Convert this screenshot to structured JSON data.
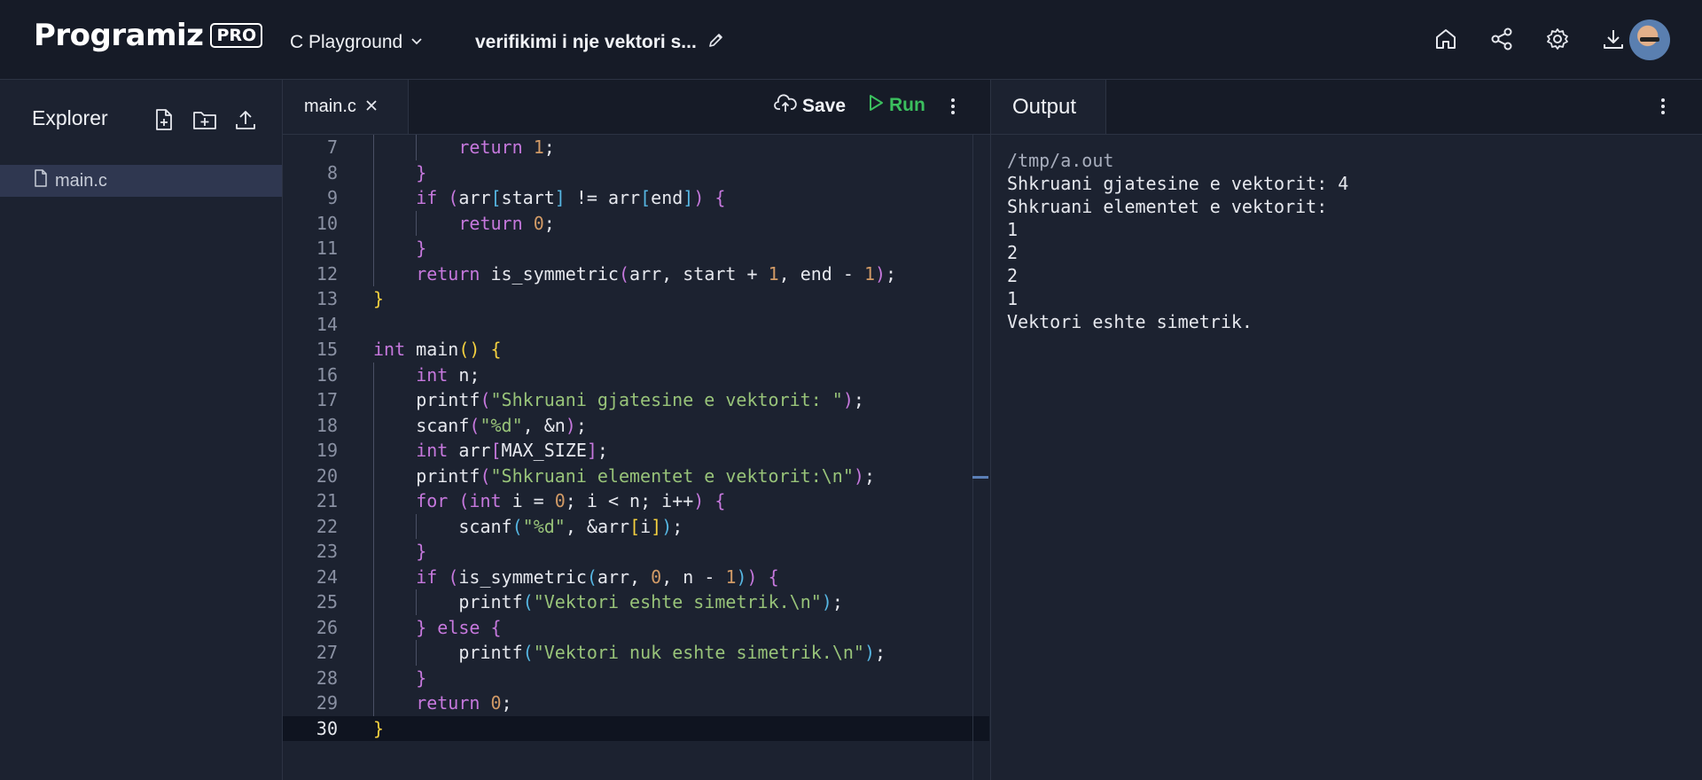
{
  "header": {
    "logo_text": "Programiz",
    "logo_badge": "PRO",
    "playground_label": "C Playground",
    "project_title": "verifikimi i nje vektori s...",
    "icons": [
      "home-icon",
      "share-icon",
      "settings-icon",
      "download-icon"
    ]
  },
  "explorer": {
    "title": "Explorer",
    "actions": [
      "new-file-icon",
      "new-folder-icon",
      "upload-icon"
    ],
    "files": [
      {
        "name": "main.c",
        "selected": true
      }
    ]
  },
  "editor": {
    "tab_label": "main.c",
    "save_label": "Save",
    "run_label": "Run",
    "active_line": 30,
    "lines": [
      {
        "n": "7",
        "indent": 2,
        "code": "return 1;"
      },
      {
        "n": "8",
        "indent": 1,
        "code": "}"
      },
      {
        "n": "9",
        "indent": 1,
        "code": "if (arr[start] != arr[end]) {"
      },
      {
        "n": "10",
        "indent": 2,
        "code": "return 0;"
      },
      {
        "n": "11",
        "indent": 1,
        "code": "}"
      },
      {
        "n": "12",
        "indent": 1,
        "code": "return is_symmetric(arr, start + 1, end - 1);"
      },
      {
        "n": "13",
        "indent": 0,
        "code": "}"
      },
      {
        "n": "14",
        "indent": 0,
        "code": ""
      },
      {
        "n": "15",
        "indent": 0,
        "code": "int main() {"
      },
      {
        "n": "16",
        "indent": 1,
        "code": "int n;"
      },
      {
        "n": "17",
        "indent": 1,
        "code": "printf(\"Shkruani gjatesine e vektorit: \");"
      },
      {
        "n": "18",
        "indent": 1,
        "code": "scanf(\"%d\", &n);"
      },
      {
        "n": "19",
        "indent": 1,
        "code": "int arr[MAX_SIZE];"
      },
      {
        "n": "20",
        "indent": 1,
        "code": "printf(\"Shkruani elementet e vektorit:\\n\");"
      },
      {
        "n": "21",
        "indent": 1,
        "code": "for (int i = 0; i < n; i++) {"
      },
      {
        "n": "22",
        "indent": 2,
        "code": "scanf(\"%d\", &arr[i]);"
      },
      {
        "n": "23",
        "indent": 1,
        "code": "}"
      },
      {
        "n": "24",
        "indent": 1,
        "code": "if (is_symmetric(arr, 0, n - 1)) {"
      },
      {
        "n": "25",
        "indent": 2,
        "code": "printf(\"Vektori eshte simetrik.\\n\");"
      },
      {
        "n": "26",
        "indent": 1,
        "code": "} else {"
      },
      {
        "n": "27",
        "indent": 2,
        "code": "printf(\"Vektori nuk eshte simetrik.\\n\");"
      },
      {
        "n": "28",
        "indent": 1,
        "code": "}"
      },
      {
        "n": "29",
        "indent": 1,
        "code": "return 0;"
      },
      {
        "n": "30",
        "indent": 0,
        "code": "}"
      }
    ]
  },
  "output": {
    "tab_label": "Output",
    "path_line": "/tmp/a.out",
    "lines": [
      "Shkruani gjatesine e vektorit: 4",
      "Shkruani elementet e vektorit:",
      "1",
      "2",
      "2",
      "1",
      "Vektori eshte simetrik."
    ]
  },
  "colors": {
    "background": "#1c2230",
    "topbar": "#161b27",
    "run_green": "#3bbf5e",
    "keyword": "#c678dd",
    "string": "#98c379",
    "number": "#d19a66"
  }
}
